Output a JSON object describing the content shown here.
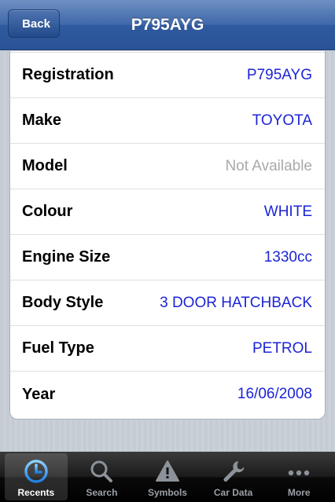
{
  "navbar": {
    "back_label": "Back",
    "title": "P795AYG"
  },
  "details": {
    "rows": [
      {
        "label": "Registration",
        "value": "P795AYG",
        "available": true
      },
      {
        "label": "Make",
        "value": "TOYOTA",
        "available": true
      },
      {
        "label": "Model",
        "value": "Not Available",
        "available": false
      },
      {
        "label": "Colour",
        "value": "WHITE",
        "available": true
      },
      {
        "label": "Engine Size",
        "value": "1330cc",
        "available": true
      },
      {
        "label": "Body Style",
        "value": "3 DOOR HATCHBACK",
        "available": true
      },
      {
        "label": "Fuel Type",
        "value": "PETROL",
        "available": true
      },
      {
        "label": "Year",
        "value": "16/06/2008",
        "available": true
      }
    ]
  },
  "tabbar": {
    "tabs": [
      {
        "label": "Recents",
        "icon": "clock-icon",
        "active": true
      },
      {
        "label": "Search",
        "icon": "magnifier-icon",
        "active": false
      },
      {
        "label": "Symbols",
        "icon": "warning-triangle-icon",
        "active": false
      },
      {
        "label": "Car Data",
        "icon": "wrench-icon",
        "active": false
      },
      {
        "label": "More",
        "icon": "ellipsis-icon",
        "active": false
      }
    ]
  },
  "colors": {
    "value_blue": "#1c24d6",
    "unavailable_grey": "#a9a9a9",
    "nav_blue": "#3f68a9"
  }
}
